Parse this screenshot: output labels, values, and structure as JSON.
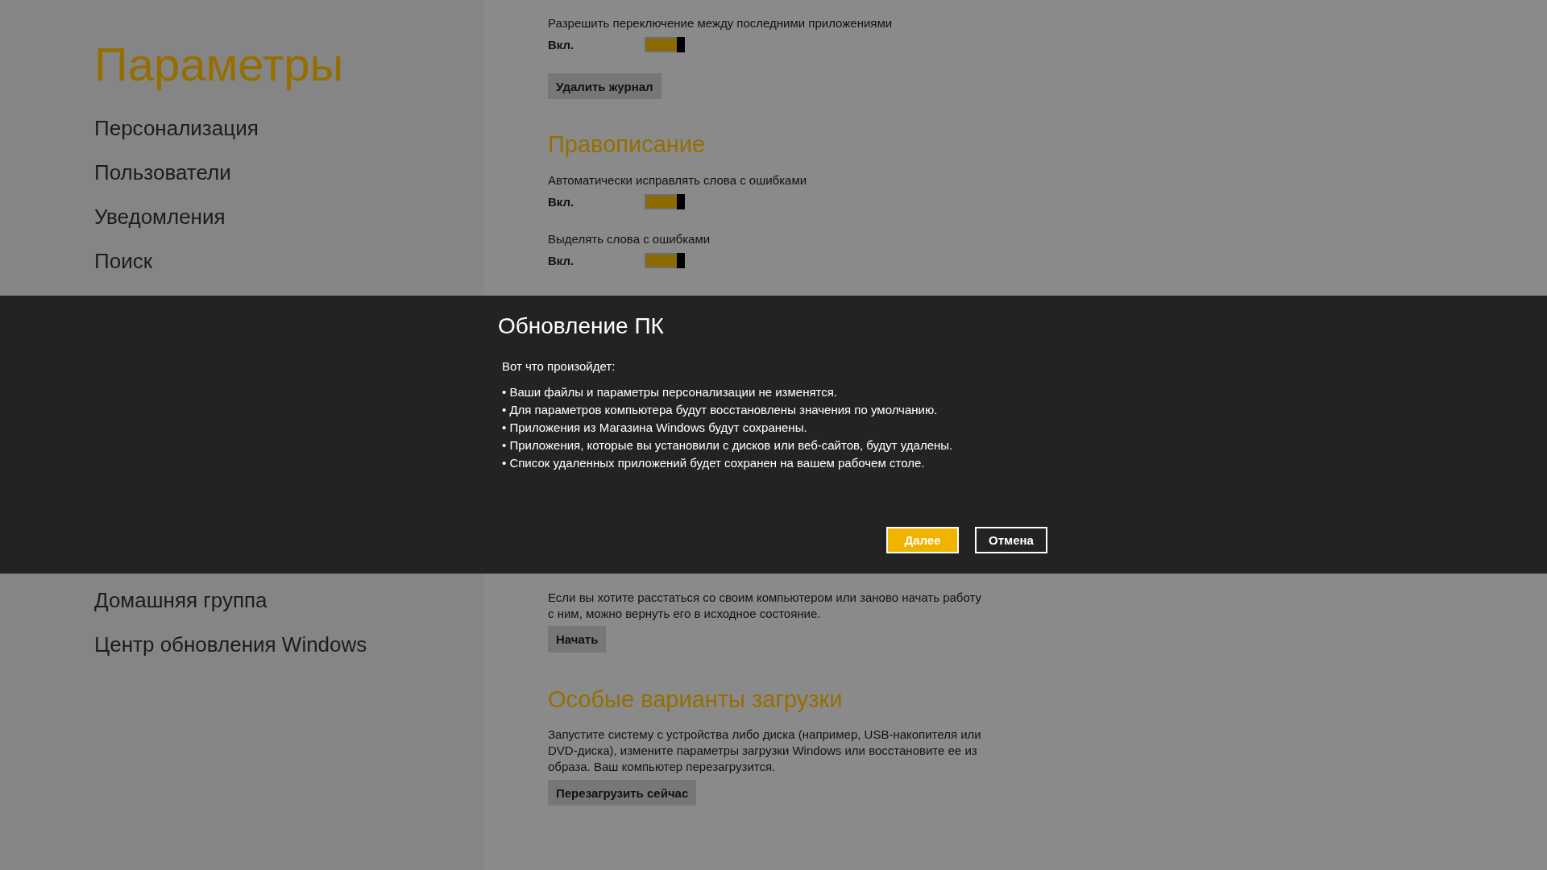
{
  "sidebar": {
    "title": "Параметры",
    "items": [
      {
        "label": "Персонализация"
      },
      {
        "label": "Пользователи"
      },
      {
        "label": "Уведомления"
      },
      {
        "label": "Поиск"
      }
    ],
    "items_below": [
      {
        "label": "Домашняя группа"
      },
      {
        "label": "Центр обновления Windows"
      }
    ]
  },
  "content": {
    "top": [
      {
        "kind": "text",
        "text": "Разрешить переключение между последними приложениями"
      },
      {
        "kind": "toggle",
        "state_label": "Вкл.",
        "on": true
      },
      {
        "kind": "button",
        "label": "Удалить журнал"
      },
      {
        "kind": "heading",
        "text": "Правописание"
      },
      {
        "kind": "text",
        "text": "Автоматически исправлять слова с ошибками"
      },
      {
        "kind": "toggle",
        "state_label": "Вкл.",
        "on": true
      },
      {
        "kind": "text",
        "text": "Выделять слова с ошибками"
      },
      {
        "kind": "toggle",
        "state_label": "Вкл.",
        "on": true
      }
    ],
    "bottom": [
      {
        "kind": "text",
        "text": "Если вы хотите расстаться со своим компьютером или заново начать работу с ним, можно вернуть его в исходное состояние."
      },
      {
        "kind": "button",
        "label": "Начать"
      },
      {
        "kind": "heading",
        "text": "Особые варианты загрузки"
      },
      {
        "kind": "text",
        "text": "Запустите систему с устройства либо диска (например, USB-накопителя или DVD-диска), измените параметры загрузки Windows или восстановите ее из образа. Ваш компьютер перезагрузится."
      },
      {
        "kind": "button",
        "label": "Перезагрузить сейчас"
      }
    ]
  },
  "dialog": {
    "title": "Обновление ПК",
    "intro": "Вот что произойдет:",
    "bullets": [
      "• Ваши файлы и параметры персонализации не изменятся.",
      "• Для параметров компьютера будут восстановлены значения по умолчанию.",
      "• Приложения из Магазина Windows будут сохранены.",
      "• Приложения, которые вы установили с дисков или веб-сайтов, будут удалены.",
      "• Список удаленных приложений будет сохранен на вашем рабочем столе."
    ],
    "buttons": [
      {
        "label": "Далее",
        "kind": "primary"
      },
      {
        "label": "Отмена",
        "kind": "secondary"
      }
    ]
  }
}
